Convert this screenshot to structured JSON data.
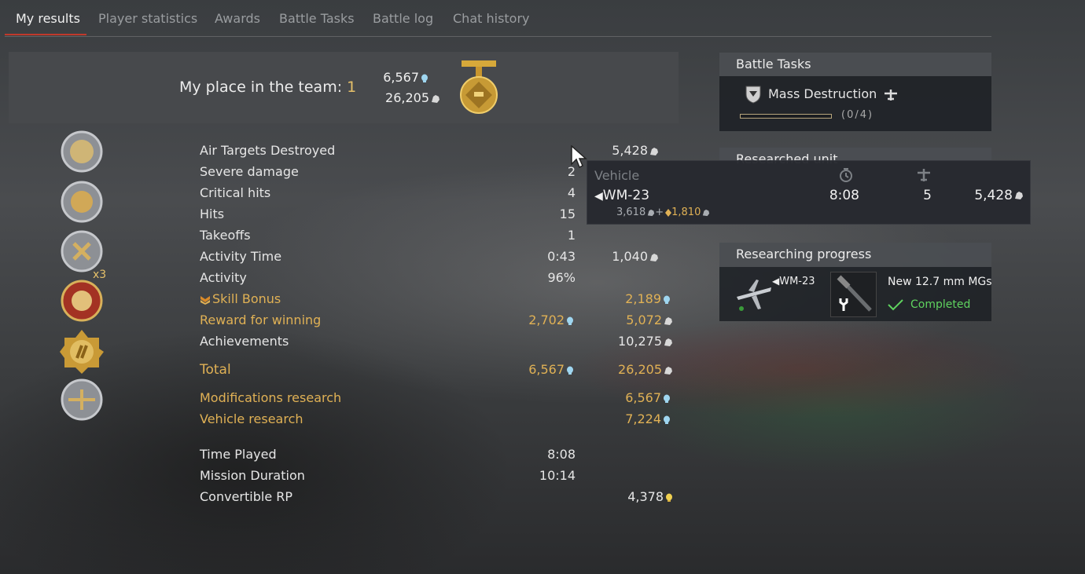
{
  "tabs": [
    "My results",
    "Player statistics",
    "Awards",
    "Battle Tasks",
    "Battle log",
    "Chat history"
  ],
  "team": {
    "place_label": "My place in the team: ",
    "place_value": "1",
    "rp": "6,567",
    "sl": "26,205"
  },
  "rows": [
    {
      "label": "Air Targets Destroyed",
      "v1": "",
      "v2": "5,428",
      "v2_icon": "sl"
    },
    {
      "label": "Severe damage",
      "v1": "2",
      "v2": ""
    },
    {
      "label": "Critical hits",
      "v1": "4",
      "v2": ""
    },
    {
      "label": "Hits",
      "v1": "15",
      "v2": ""
    },
    {
      "label": "Takeoffs",
      "v1": "1",
      "v2": ""
    },
    {
      "label": "Activity Time",
      "v1": "0:43",
      "v2": "1,040",
      "v2_icon": "sl"
    },
    {
      "label": "Activity",
      "v1": "96%",
      "v2": ""
    },
    {
      "label": "Skill Bonus",
      "v1": "",
      "v2": "2,189",
      "v2_icon": "rp",
      "gold": true
    },
    {
      "label": "Reward for winning",
      "v1": "2,702",
      "v1_icon": "rp",
      "v2": "5,072",
      "v2_icon": "sl",
      "gold": true
    },
    {
      "label": "Achievements",
      "v1": "",
      "v2": "10,275",
      "v2_icon": "sl"
    }
  ],
  "total": {
    "label": "Total",
    "rp": "6,567",
    "sl": "26,205"
  },
  "research": [
    {
      "label": "Modifications research",
      "value": "6,567"
    },
    {
      "label": "Vehicle research",
      "value": "7,224"
    }
  ],
  "times": [
    {
      "label": "Time Played",
      "value": "8:08"
    },
    {
      "label": "Mission Duration",
      "value": "10:14"
    }
  ],
  "convertible": {
    "label": "Convertible RP",
    "value": "4,378"
  },
  "awards_multiplier": "x3",
  "battle_tasks": {
    "title": "Battle Tasks",
    "task": "Mass Destruction",
    "progress_text": "(0/4)",
    "progress_fraction": 0.0
  },
  "researched_unit": {
    "title": "Researched unit"
  },
  "tooltip": {
    "header": "Vehicle",
    "vehicle": "WM-23",
    "time": "8:08",
    "kills": "5",
    "sl": "5,428",
    "base_sl": "3,618",
    "bonus_sl": "1,810",
    "plus": "+"
  },
  "researching": {
    "title": "Researching progress",
    "vehicle": "WM-23",
    "module": "New 12.7 mm MGs",
    "status": "Completed"
  },
  "colors": {
    "gold": "#e0b155",
    "accent_tab": "#c0392b",
    "completed": "#5fd35f"
  },
  "icons": {
    "rp": "research-points-icon",
    "sl": "silver-lions-icon",
    "medal": "medal-icon",
    "plane": "plane-icon",
    "clock": "clock-icon",
    "wrench": "wrench-icon",
    "check": "check-icon"
  }
}
